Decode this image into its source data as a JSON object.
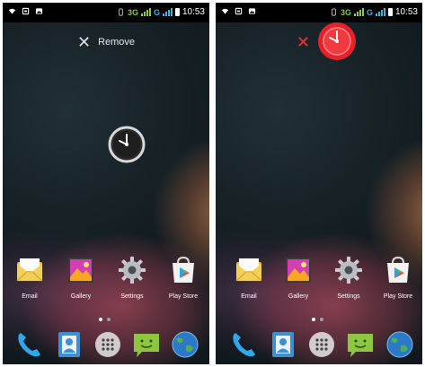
{
  "screens": [
    {
      "status": {
        "network_a": "3G",
        "network_b": "G",
        "time": "10:53"
      },
      "remove_label": "Remove",
      "apps": [
        {
          "label": "Email",
          "icon": "email-icon"
        },
        {
          "label": "Gallery",
          "icon": "gallery-icon"
        },
        {
          "label": "Settings",
          "icon": "settings-icon"
        },
        {
          "label": "Play Store",
          "icon": "play-store-icon"
        }
      ],
      "dock": [
        "phone-icon",
        "contacts-icon",
        "app-drawer-icon",
        "messaging-icon",
        "browser-icon"
      ]
    },
    {
      "status": {
        "network_a": "3G",
        "network_b": "G",
        "time": "10:53"
      },
      "apps": [
        {
          "label": "Email",
          "icon": "email-icon"
        },
        {
          "label": "Gallery",
          "icon": "gallery-icon"
        },
        {
          "label": "Settings",
          "icon": "settings-icon"
        },
        {
          "label": "Play Store",
          "icon": "play-store-icon"
        }
      ],
      "dock": [
        "phone-icon",
        "contacts-icon",
        "app-drawer-icon",
        "messaging-icon",
        "browser-icon"
      ]
    }
  ],
  "colors": {
    "remove_red": "#e23a3a",
    "dragged_widget_red": "#e8202a",
    "status_blue": "#33b5e5",
    "status_green": "#88cc33"
  }
}
